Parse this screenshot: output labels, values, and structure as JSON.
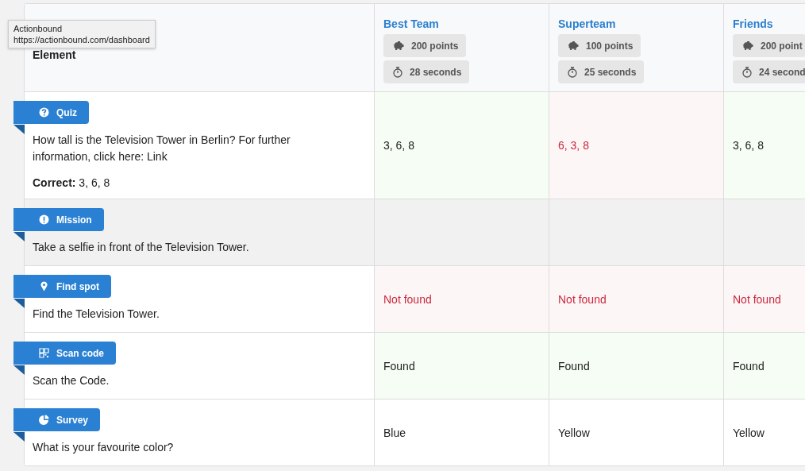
{
  "tooltip": {
    "title": "Actionbound",
    "url": "https://actionbound.com/dashboard"
  },
  "table": {
    "element_heading": "Element",
    "teams": [
      {
        "name": "Best Team",
        "points": "200 points",
        "time": "28 seconds"
      },
      {
        "name": "Superteam",
        "points": "100 points",
        "time": "25 seconds"
      },
      {
        "name": "Friends",
        "points": "200 point",
        "time": "24 second"
      }
    ],
    "rows": [
      {
        "kind": "quiz",
        "label": "Quiz",
        "text": "How tall is the Television Tower in Berlin? For further information, click here: Link",
        "correct": "**Correct:** 3, 6, 8",
        "pending": false,
        "results": [
          {
            "value": "3, 6, 8",
            "correct": true
          },
          {
            "value": "6, 3, 8",
            "correct": false
          },
          {
            "value": "3, 6, 8",
            "correct": true
          }
        ]
      },
      {
        "kind": "mission",
        "label": "Mission",
        "text": "Take a selfie in front of the Television Tower.",
        "pending": true
      },
      {
        "kind": "spot",
        "label": "Find spot",
        "text": "Find the Television Tower.",
        "pending": false,
        "results": [
          {
            "value": "Not found",
            "correct": false
          },
          {
            "value": "Not found",
            "correct": false
          },
          {
            "value": "Not found",
            "correct": false
          }
        ]
      },
      {
        "kind": "code",
        "label": "Scan code",
        "text": "Scan the Code.",
        "pending": false,
        "results": [
          {
            "value": "Found",
            "correct": true
          },
          {
            "value": "Found",
            "correct": true
          },
          {
            "value": "Found",
            "correct": true
          }
        ]
      },
      {
        "kind": "survey",
        "label": "Survey",
        "text": "What is your favourite color?",
        "pending": false,
        "results": [
          {
            "value": "Blue"
          },
          {
            "value": "Yellow"
          },
          {
            "value": "Yellow"
          }
        ]
      }
    ]
  }
}
